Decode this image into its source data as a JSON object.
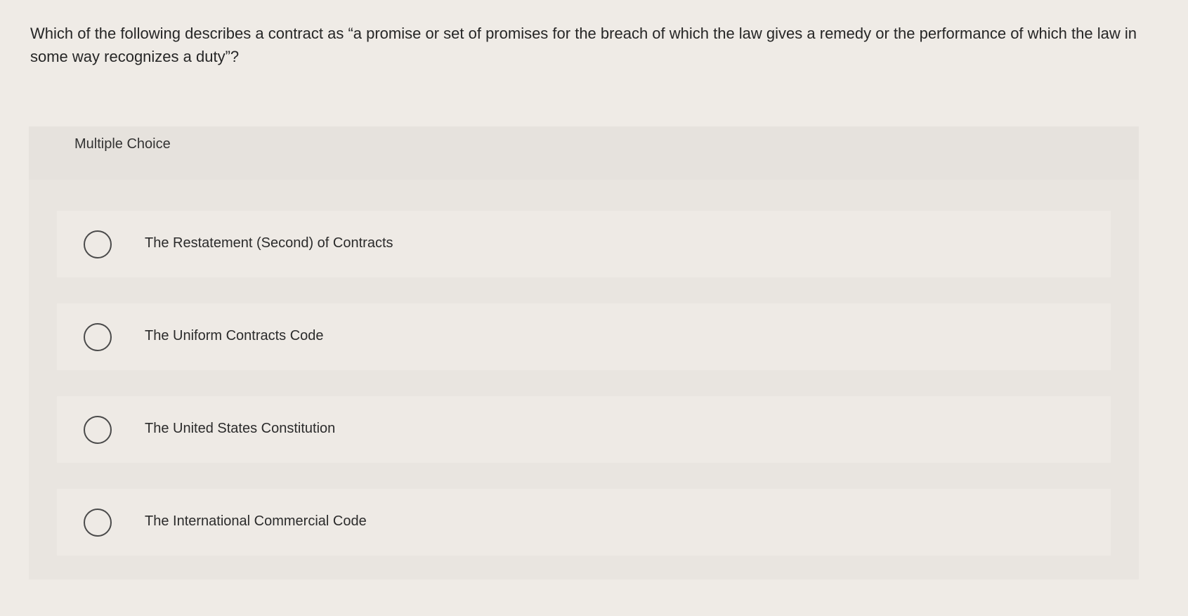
{
  "question": {
    "text": "Which of the following describes a contract as “a promise or set of promises for the breach of which the law gives a remedy or the performance of which the law in some way recognizes a duty”?"
  },
  "multiple_choice": {
    "title": "Multiple Choice",
    "options": [
      {
        "label": "The Restatement (Second) of Contracts",
        "selected": false
      },
      {
        "label": "The Uniform Contracts Code",
        "selected": false
      },
      {
        "label": "The United States Constitution",
        "selected": false
      },
      {
        "label": "The International Commercial Code",
        "selected": false
      }
    ]
  }
}
